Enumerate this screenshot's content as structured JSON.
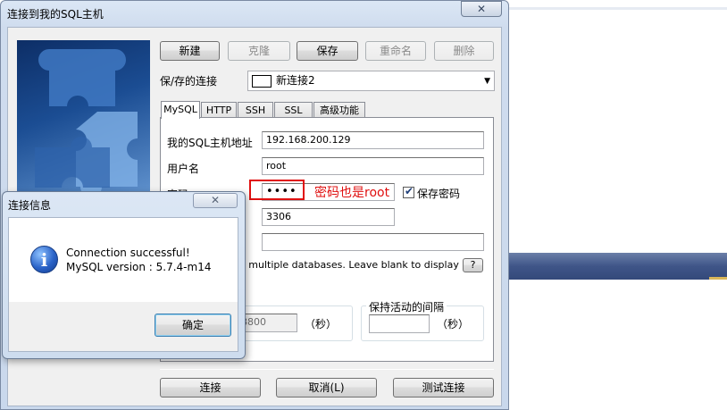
{
  "window": {
    "title": "连接到我的SQL主机",
    "close_glyph": "✕"
  },
  "toolbar": {
    "new": "新建",
    "clone": "克隆",
    "save": "保存",
    "rename": "重命名",
    "delete": "删除"
  },
  "saved_connection": {
    "label": "保/存的连接",
    "value": "新连接2"
  },
  "tabs": [
    {
      "label": "MySQL",
      "active": true
    },
    {
      "label": "HTTP"
    },
    {
      "label": "SSH"
    },
    {
      "label": "SSL"
    },
    {
      "label": "高级功能"
    }
  ],
  "form": {
    "host_label": "我的SQL主机地址",
    "host_value": "192.168.200.129",
    "user_label": "用户名",
    "user_value": "root",
    "password_label": "密码",
    "password_value": "••••",
    "save_password_label": "保存密码",
    "save_password_checked": true,
    "port_value": "3306",
    "database_value": "",
    "db_hint": "e multiple databases. Leave blank to display all)",
    "help_label": "?",
    "timeout_value": "28800",
    "timeout_unit": "（秒）",
    "keepalive_label": "保持活动的间隔",
    "keepalive_value": "",
    "keepalive_unit": "（秒）"
  },
  "annotation": {
    "text": "密码也是root",
    "color": "#e01010"
  },
  "footer": {
    "connect": "连接",
    "cancel": "取消(L)",
    "test": "测试连接"
  },
  "dialog": {
    "title": "连接信息",
    "close_glyph": "✕",
    "icon": "info-icon",
    "message_line1": "Connection successful!",
    "message_line2": "MySQL version : 5.7.4-m14",
    "ok": "确定"
  }
}
